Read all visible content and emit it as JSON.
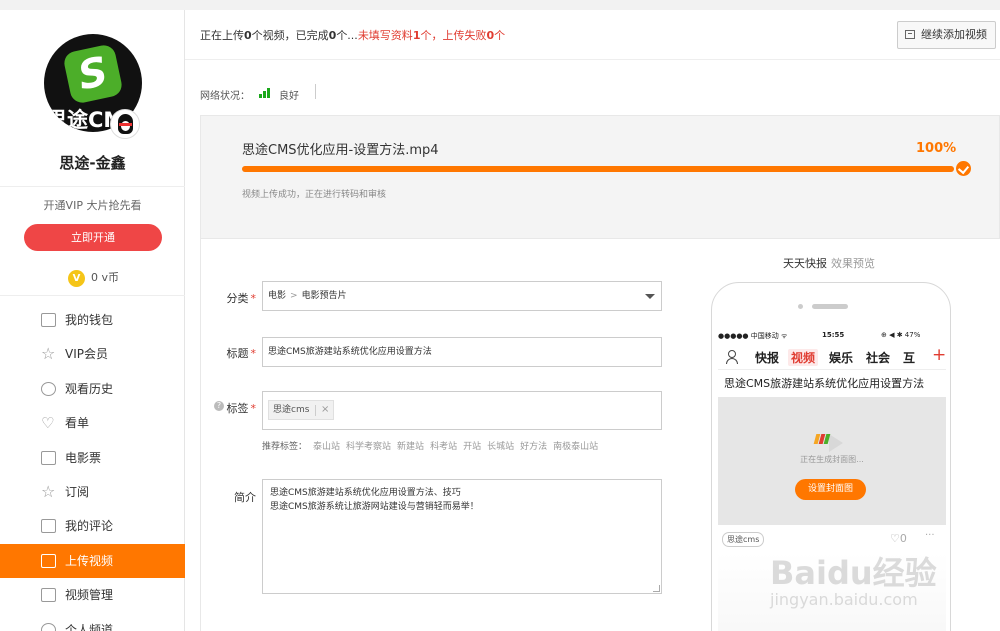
{
  "sidebar": {
    "avatar_brand": "思途CMS",
    "username": "思途-金鑫",
    "vip_tip": "开通VIP 大片抢先看",
    "open_button": "立即开通",
    "vcoin_icon": "V",
    "vcoin": "0 v币",
    "items": [
      {
        "label": "我的钱包",
        "icon": "wallet-icon"
      },
      {
        "label": "VIP会员",
        "icon": "star-icon"
      },
      {
        "label": "观看历史",
        "icon": "history-icon"
      },
      {
        "label": "看单",
        "icon": "heart-icon"
      },
      {
        "label": "电影票",
        "icon": "ticket-icon"
      },
      {
        "label": "订阅",
        "icon": "star-icon"
      },
      {
        "label": "我的评论",
        "icon": "comment-icon"
      },
      {
        "label": "上传视频",
        "icon": "upload-icon",
        "active": true
      },
      {
        "label": "视频管理",
        "icon": "video-manage-icon"
      },
      {
        "label": "个人频道",
        "icon": "channel-icon"
      }
    ],
    "active_color": "#ff7700"
  },
  "status": {
    "p1": "正在上传",
    "uploading": "0",
    "p2": "个视频，已完成",
    "done": "0",
    "p3": "个...",
    "p4": "未填写资料",
    "unfilled": "1",
    "p5": "个，上传失败",
    "failed": "0",
    "p6": "个",
    "continue_button": "继续添加视频"
  },
  "network": {
    "label": "网络状况：",
    "quality": "良好"
  },
  "upload": {
    "file_name": "思途CMS优化应用-设置方法.mp4",
    "percent_text": "100%",
    "progress": 1.0,
    "message": "视频上传成功，正在进行转码和审核"
  },
  "form": {
    "category_label": "分类",
    "category_path_1": "电影",
    "category_sep": ">",
    "category_path_2": "电影预告片",
    "title_label": "标题",
    "title_value": "思途CMS旅游建站系统优化应用设置方法",
    "tags_label": "标签",
    "tag_value": "思途cms",
    "tag_remove": "×",
    "rec_label": "推荐标签：",
    "rec_tags": [
      "泰山站",
      "科学考察站",
      "新建站",
      "科考站",
      "开站",
      "长城站",
      "好方法",
      "南极泰山站"
    ],
    "intro_label": "简介",
    "intro_line1": "思途CMS旅游建站系统优化应用设置方法、技巧",
    "intro_line2": "思途CMS旅游系统让旅游网站建设与营销轻而易举！",
    "required_mark": "*"
  },
  "preview": {
    "title": "天天快报",
    "subtitle": "效果预览",
    "status_left": "●●●●● 中国移动 ᯤ",
    "status_time": "15:55",
    "status_right": "⊕ ◀ ✱ 47%",
    "tabs": [
      "快报",
      "视频",
      "娱乐",
      "社会",
      "互"
    ],
    "active_tab": "视频",
    "plus": "+",
    "video_title": "思途CMS旅游建站系统优化应用设置方法",
    "generating": "正在生成封面图...",
    "cover_button": "设置封面图",
    "tag": "思途cms",
    "like": "♡0",
    "more": "···"
  },
  "watermark": {
    "main": "Baidu经验",
    "sub": "jingyan.baidu.com"
  },
  "colors": {
    "accent": "#ff7700",
    "red": "#e03c31",
    "green": "#1aa81a"
  }
}
